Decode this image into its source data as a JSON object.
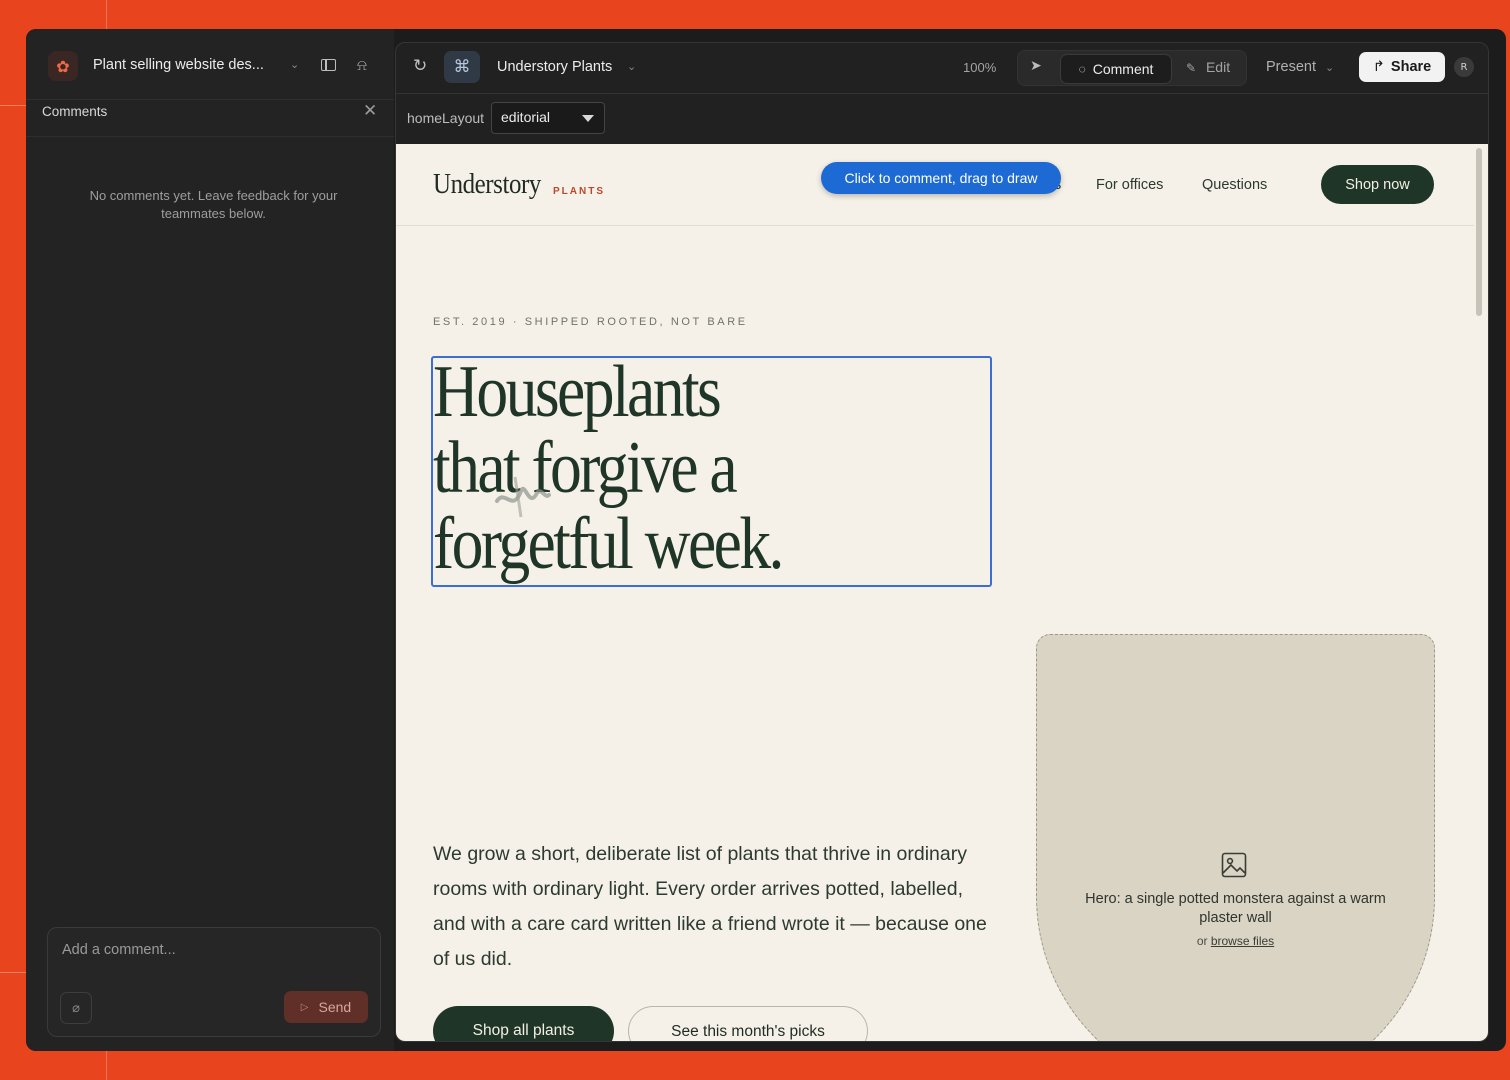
{
  "app": {
    "project_title": "Plant selling website des...",
    "panel_title": "Comments",
    "empty_message": "No comments yet. Leave feedback for your teammates below.",
    "composer_placeholder": "Add a comment...",
    "send_label": "Send"
  },
  "toolbar": {
    "page_name": "Understory Plants",
    "zoom": "100%",
    "comment_label": "Comment",
    "edit_label": "Edit",
    "present_label": "Present",
    "share_label": "Share",
    "avatar_initial": "R"
  },
  "props": {
    "label": "homeLayout",
    "value": "editorial"
  },
  "site": {
    "brand": "Understory",
    "brand_sub": "PLANTS",
    "nav_partial": "s",
    "nav": [
      "For offices",
      "Questions"
    ],
    "cta": "Shop now",
    "tooltip": "Click to comment, drag to draw",
    "eyebrow": "EST. 2019 · SHIPPED ROOTED, NOT BARE",
    "headline": "Houseplants\nthat forgive a\nforgetful week.",
    "body": "We grow a short, deliberate list of plants that thrive in ordinary rooms with ordinary light. Every order arrives potted, labelled, and with a care card written like a friend wrote it — because one of us did.",
    "btn_primary": "Shop all plants",
    "btn_secondary": "See this month's picks",
    "hero_caption": "Hero: a single potted monstera against a warm plaster wall",
    "hero_or": "or",
    "hero_browse": "browse files"
  },
  "colors": {
    "outer_bg": "#e8451e",
    "accent_blue": "#1e6ad4",
    "forest": "#1f3527",
    "cream": "#f5f1e8"
  }
}
